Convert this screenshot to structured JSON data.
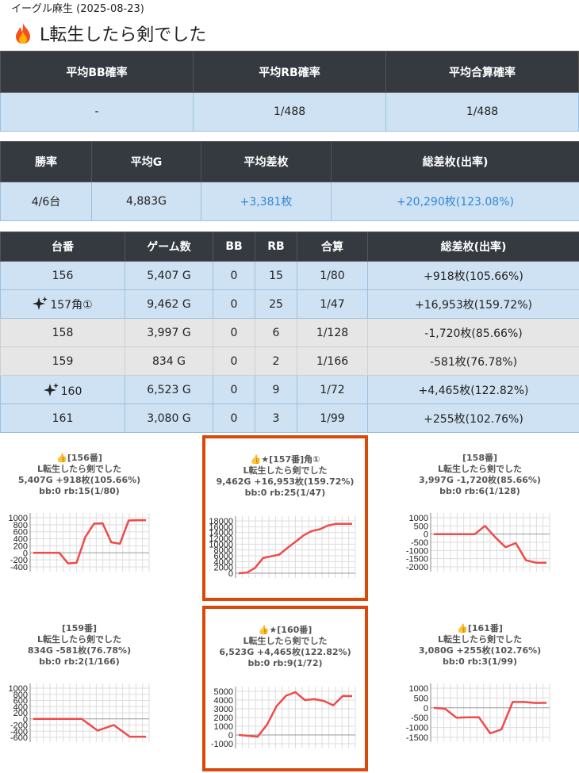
{
  "header": {
    "store": "イーグル麻生 (2025-08-23)",
    "title": "L転生したら剣でした"
  },
  "summary1": {
    "headers": [
      "平均BB確率",
      "平均RB確率",
      "平均合算確率"
    ],
    "values": [
      "-",
      "1/488",
      "1/488"
    ]
  },
  "summary2": {
    "headers": [
      "勝率",
      "平均G",
      "平均差枚",
      "総差枚(出率)"
    ],
    "values": [
      "4/6台",
      "4,883G",
      "+3,381枚",
      "+20,290枚(123.08%)"
    ]
  },
  "machines": {
    "headers": [
      "台番",
      "ゲーム数",
      "BB",
      "RB",
      "合算",
      "総差枚(出率)"
    ],
    "rows": [
      {
        "no": "156",
        "games": "5,407 G",
        "bb": "0",
        "rb": "15",
        "total": "1/80",
        "diff": "+918枚(105.66%)",
        "style": "blue",
        "sparkle": false
      },
      {
        "no": "157角①",
        "games": "9,462 G",
        "bb": "0",
        "rb": "25",
        "total": "1/47",
        "diff": "+16,953枚(159.72%)",
        "style": "blue",
        "sparkle": true
      },
      {
        "no": "158",
        "games": "3,997 G",
        "bb": "0",
        "rb": "6",
        "total": "1/128",
        "diff": "-1,720枚(85.66%)",
        "style": "gray",
        "sparkle": false
      },
      {
        "no": "159",
        "games": "834 G",
        "bb": "0",
        "rb": "2",
        "total": "1/166",
        "diff": "-581枚(76.78%)",
        "style": "gray",
        "sparkle": false
      },
      {
        "no": "160",
        "games": "6,523 G",
        "bb": "0",
        "rb": "9",
        "total": "1/72",
        "diff": "+4,465枚(122.82%)",
        "style": "blue",
        "sparkle": true
      },
      {
        "no": "161",
        "games": "3,080 G",
        "bb": "0",
        "rb": "3",
        "total": "1/99",
        "diff": "+255枚(102.76%)",
        "style": "blue",
        "sparkle": false
      }
    ]
  },
  "colors": {
    "line": "#f04a4a",
    "highlight": "#d9490a",
    "header_bg": "#343a40",
    "row_blue": "#cfe2f3",
    "row_gray": "#e6e6e6"
  },
  "chart_data": [
    {
      "type": "line",
      "caption": [
        "👍[156番]",
        "L転生したら剣でした",
        "5,407G +918枚(105.66%)",
        "bb:0 rb:15(1/80)"
      ],
      "yticks": [
        1000,
        800,
        600,
        400,
        200,
        0,
        -200,
        -400
      ],
      "ylim": [
        -400,
        1000
      ],
      "values": [
        0,
        0,
        0,
        0,
        -300,
        -280,
        450,
        830,
        840,
        300,
        260,
        920,
        930,
        930
      ]
    },
    {
      "type": "line",
      "caption": [
        "👍★[157番]角①",
        "L転生したら剣でした",
        "9,462G +16,953枚(159.72%)",
        "bb:0 rb:25(1/47)"
      ],
      "yticks": [
        18000,
        16000,
        14000,
        12000,
        10000,
        8000,
        6000,
        4000,
        2000,
        0
      ],
      "ylim": [
        0,
        18000
      ],
      "values": [
        0,
        200,
        1800,
        5200,
        5800,
        6400,
        8700,
        10800,
        13000,
        14500,
        15100,
        16400,
        17000,
        16950,
        16950
      ]
    },
    {
      "type": "line",
      "caption": [
        "[158番]",
        "L転生したら剣でした",
        "3,997G -1,720枚(85.66%)",
        "bb:0 rb:6(1/128)"
      ],
      "yticks": [
        1000,
        500,
        0,
        -500,
        -1000,
        -1500,
        -2000
      ],
      "ylim": [
        -2000,
        1000
      ],
      "values": [
        0,
        0,
        0,
        0,
        0,
        500,
        -200,
        -800,
        -550,
        -1600,
        -1750,
        -1750
      ]
    },
    {
      "type": "line",
      "caption": [
        "[159番]",
        "L転生したら剣でした",
        "834G -581枚(76.78%)",
        "bb:0 rb:2(1/166)"
      ],
      "yticks": [
        1000,
        800,
        600,
        400,
        200,
        0,
        -200,
        -400,
        -600
      ],
      "ylim": [
        -600,
        1000
      ],
      "values": [
        0,
        0,
        0,
        0,
        -380,
        -200,
        -580,
        -580
      ]
    },
    {
      "type": "line",
      "caption": [
        "👍★[160番]",
        "L転生したら剣でした",
        "6,523G +4,465枚(122.82%)",
        "bb:0 rb:9(1/72)"
      ],
      "yticks": [
        5000,
        4000,
        3000,
        2000,
        1000,
        0,
        -1000
      ],
      "ylim": [
        -1000,
        5000
      ],
      "values": [
        0,
        -100,
        -200,
        1200,
        3300,
        4500,
        4900,
        4000,
        4100,
        3900,
        3400,
        4465,
        4450
      ]
    },
    {
      "type": "line",
      "caption": [
        "👍[161番]",
        "L転生したら剣でした",
        "3,080G +255枚(102.76%)",
        "bb:0 rb:3(1/99)"
      ],
      "yticks": [
        1000,
        500,
        0,
        -500,
        -1000,
        -1500
      ],
      "ylim": [
        -1500,
        1000
      ],
      "values": [
        0,
        -50,
        -500,
        -480,
        -480,
        -1300,
        -1100,
        300,
        300,
        250,
        255
      ]
    }
  ]
}
